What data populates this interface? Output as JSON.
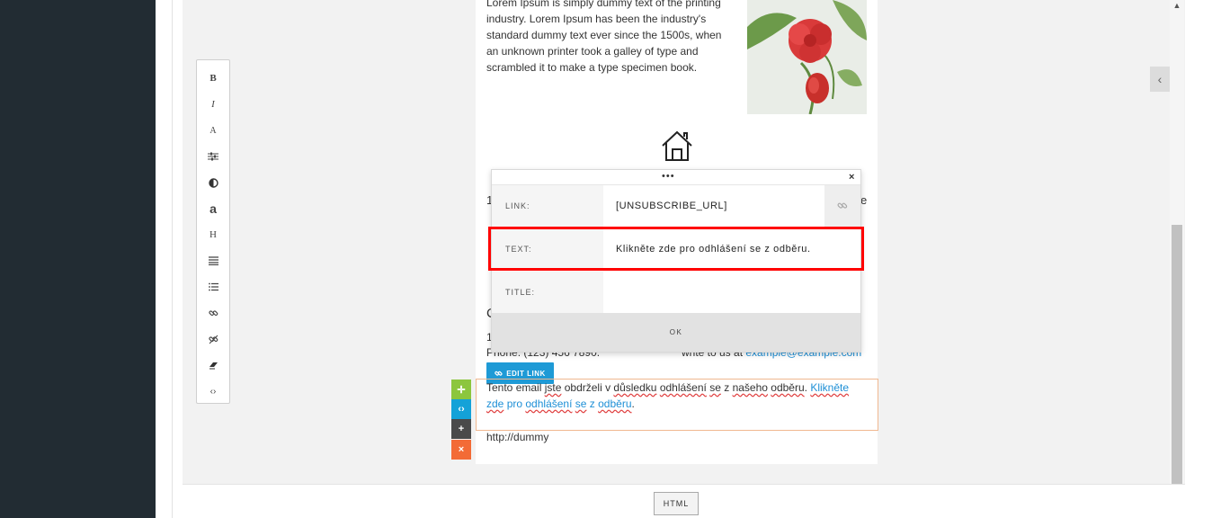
{
  "toolbar": {
    "bold": "B",
    "italic": "I",
    "font": "A",
    "style": "≡",
    "color": "◑",
    "fontsize": "a",
    "heading": "H",
    "align": "≡",
    "list": "☰",
    "link": "⊙",
    "unlink": "⊘",
    "clear": "▰",
    "source": "‹›"
  },
  "email": {
    "lorem": "Lorem Ipsum is simply dummy text of the printing industry. Lorem Ipsum has been the industry's standard dummy text ever since the 1500s, when an unknown printer took a galley of type and scrambled it to make a type specimen book.",
    "stray_1": "1",
    "stray_e": "e",
    "stray_c": "C",
    "stray_1b": "1",
    "phone": "Phone: (123) 456 7890.",
    "write_prefix": "write to us at ",
    "write_email": "example@example.com",
    "edit_link": "EDIT LINK",
    "unsub": {
      "w1": "Tento email ",
      "w2": "jste",
      "w3": " obdrželi v ",
      "w4": "důsledku",
      "w5": " ",
      "w6": "odhlášení",
      "w7": " ",
      "w8": "se",
      "w9": " z ",
      "w10": "našeho",
      "w11": " ",
      "w12": "odběru",
      "w13": ". ",
      "l1": "Klikněte",
      "l2": "zde",
      "l3": " pro ",
      "l4": "odhlášení",
      "l5": " ",
      "l6": "se",
      "l7": " z ",
      "l8": "odběru",
      "end": "."
    },
    "dummy": "http://dummy"
  },
  "modal": {
    "dots": "•••",
    "close": "×",
    "link_label": "LINK:",
    "link_value": "[UNSUBSCRIBE_URL]",
    "text_label": "TEXT:",
    "text_value": "Klikněte zde pro odhlášení se z odběru.",
    "title_label": "TITLE:",
    "title_value": "",
    "ok": "OK"
  },
  "controls": {
    "move": "✛",
    "code": "‹›",
    "add": "+",
    "delete": "×"
  },
  "bottom": {
    "html_button": "HTML"
  },
  "colors": {
    "left_panel": "#222c33",
    "accent_blue": "#1e9ad6",
    "move_green": "#8cc63e",
    "delete_orange": "#f36b36",
    "highlight_red": "#ff0000"
  }
}
